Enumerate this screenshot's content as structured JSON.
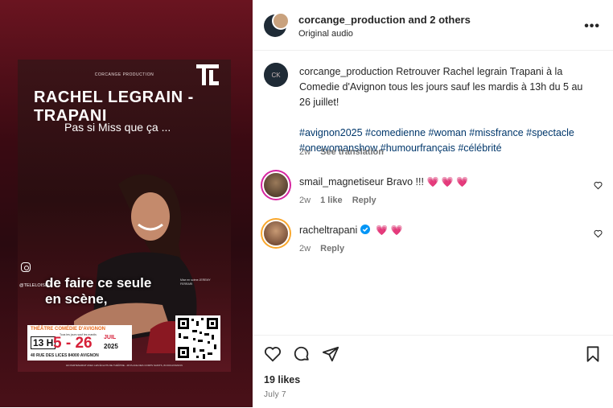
{
  "poster": {
    "producer": "CORCANGE PRODUCTION",
    "logo_text": "TL",
    "name": "RACHEL LEGRAIN - TRAPANI",
    "tagline": "Pas si Miss que ça ...",
    "phrase_line1": "de faire ce seule",
    "phrase_line2": "en scène,",
    "handle": "@TELELOISIRS",
    "credit": "Mise en scène JEREMY FERRARI",
    "theatre": "THÉÂTRE COMÉDIE D'AVIGNON",
    "days": "Tous les jours sauf les mardis",
    "time": "13 H",
    "dates": "5 - 26",
    "month": "JUIL",
    "year": "2025",
    "address": "40 RUE DES LICES 84000 AVIGNON",
    "footer": "EN PARTENARIAT AVEC LES ÉCLATS DE THÉÂTRE - 28 PLACE DES CORPS SAINTS, 84 000 AVIGNON"
  },
  "header": {
    "author": "corcange_production",
    "and_others": "and 2 others",
    "audio": "Original audio"
  },
  "caption": {
    "username": "corcange_production",
    "text": "Retrouver Rachel legrain Trapani à la Comedie d'Avignon tous les jours sauf les mardis à 13h du 5 au 26 juillet!",
    "hashtags": "#avignon2025 #comedienne #woman #missfrance #spectacle #onewomanshow #humourfrançais #célébrité",
    "time": "2w",
    "see_translation": "See translation"
  },
  "comments": [
    {
      "username": "smail_magnetiseur",
      "text": "Bravo !!!",
      "hearts": "💗 💗 💗",
      "time": "2w",
      "likes": "1 like",
      "reply": "Reply"
    },
    {
      "username": "racheltrapani",
      "text": "",
      "hearts": "💗 💗",
      "time": "2w",
      "reply": "Reply"
    }
  ],
  "likes": "19 likes",
  "date": "July 7",
  "colors": {
    "hashtag": "#00376b",
    "verified": "#0095f6",
    "heart": "#ed4956",
    "muted": "#737373"
  }
}
